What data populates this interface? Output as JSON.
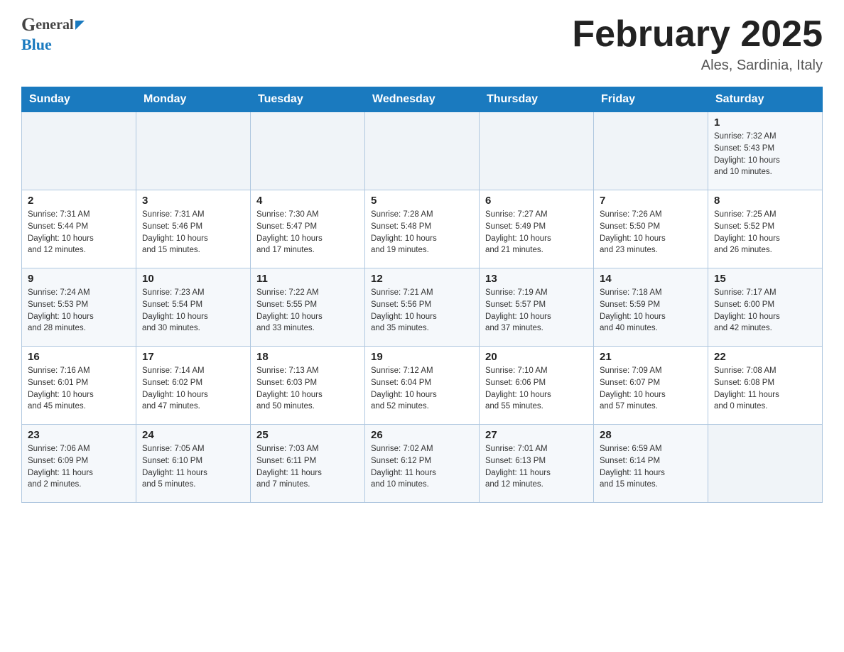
{
  "header": {
    "logo_line1": "General",
    "logo_line2": "Blue",
    "month_title": "February 2025",
    "location": "Ales, Sardinia, Italy"
  },
  "weekdays": [
    "Sunday",
    "Monday",
    "Tuesday",
    "Wednesday",
    "Thursday",
    "Friday",
    "Saturday"
  ],
  "weeks": [
    [
      {
        "day": "",
        "info": ""
      },
      {
        "day": "",
        "info": ""
      },
      {
        "day": "",
        "info": ""
      },
      {
        "day": "",
        "info": ""
      },
      {
        "day": "",
        "info": ""
      },
      {
        "day": "",
        "info": ""
      },
      {
        "day": "1",
        "info": "Sunrise: 7:32 AM\nSunset: 5:43 PM\nDaylight: 10 hours\nand 10 minutes."
      }
    ],
    [
      {
        "day": "2",
        "info": "Sunrise: 7:31 AM\nSunset: 5:44 PM\nDaylight: 10 hours\nand 12 minutes."
      },
      {
        "day": "3",
        "info": "Sunrise: 7:31 AM\nSunset: 5:46 PM\nDaylight: 10 hours\nand 15 minutes."
      },
      {
        "day": "4",
        "info": "Sunrise: 7:30 AM\nSunset: 5:47 PM\nDaylight: 10 hours\nand 17 minutes."
      },
      {
        "day": "5",
        "info": "Sunrise: 7:28 AM\nSunset: 5:48 PM\nDaylight: 10 hours\nand 19 minutes."
      },
      {
        "day": "6",
        "info": "Sunrise: 7:27 AM\nSunset: 5:49 PM\nDaylight: 10 hours\nand 21 minutes."
      },
      {
        "day": "7",
        "info": "Sunrise: 7:26 AM\nSunset: 5:50 PM\nDaylight: 10 hours\nand 23 minutes."
      },
      {
        "day": "8",
        "info": "Sunrise: 7:25 AM\nSunset: 5:52 PM\nDaylight: 10 hours\nand 26 minutes."
      }
    ],
    [
      {
        "day": "9",
        "info": "Sunrise: 7:24 AM\nSunset: 5:53 PM\nDaylight: 10 hours\nand 28 minutes."
      },
      {
        "day": "10",
        "info": "Sunrise: 7:23 AM\nSunset: 5:54 PM\nDaylight: 10 hours\nand 30 minutes."
      },
      {
        "day": "11",
        "info": "Sunrise: 7:22 AM\nSunset: 5:55 PM\nDaylight: 10 hours\nand 33 minutes."
      },
      {
        "day": "12",
        "info": "Sunrise: 7:21 AM\nSunset: 5:56 PM\nDaylight: 10 hours\nand 35 minutes."
      },
      {
        "day": "13",
        "info": "Sunrise: 7:19 AM\nSunset: 5:57 PM\nDaylight: 10 hours\nand 37 minutes."
      },
      {
        "day": "14",
        "info": "Sunrise: 7:18 AM\nSunset: 5:59 PM\nDaylight: 10 hours\nand 40 minutes."
      },
      {
        "day": "15",
        "info": "Sunrise: 7:17 AM\nSunset: 6:00 PM\nDaylight: 10 hours\nand 42 minutes."
      }
    ],
    [
      {
        "day": "16",
        "info": "Sunrise: 7:16 AM\nSunset: 6:01 PM\nDaylight: 10 hours\nand 45 minutes."
      },
      {
        "day": "17",
        "info": "Sunrise: 7:14 AM\nSunset: 6:02 PM\nDaylight: 10 hours\nand 47 minutes."
      },
      {
        "day": "18",
        "info": "Sunrise: 7:13 AM\nSunset: 6:03 PM\nDaylight: 10 hours\nand 50 minutes."
      },
      {
        "day": "19",
        "info": "Sunrise: 7:12 AM\nSunset: 6:04 PM\nDaylight: 10 hours\nand 52 minutes."
      },
      {
        "day": "20",
        "info": "Sunrise: 7:10 AM\nSunset: 6:06 PM\nDaylight: 10 hours\nand 55 minutes."
      },
      {
        "day": "21",
        "info": "Sunrise: 7:09 AM\nSunset: 6:07 PM\nDaylight: 10 hours\nand 57 minutes."
      },
      {
        "day": "22",
        "info": "Sunrise: 7:08 AM\nSunset: 6:08 PM\nDaylight: 11 hours\nand 0 minutes."
      }
    ],
    [
      {
        "day": "23",
        "info": "Sunrise: 7:06 AM\nSunset: 6:09 PM\nDaylight: 11 hours\nand 2 minutes."
      },
      {
        "day": "24",
        "info": "Sunrise: 7:05 AM\nSunset: 6:10 PM\nDaylight: 11 hours\nand 5 minutes."
      },
      {
        "day": "25",
        "info": "Sunrise: 7:03 AM\nSunset: 6:11 PM\nDaylight: 11 hours\nand 7 minutes."
      },
      {
        "day": "26",
        "info": "Sunrise: 7:02 AM\nSunset: 6:12 PM\nDaylight: 11 hours\nand 10 minutes."
      },
      {
        "day": "27",
        "info": "Sunrise: 7:01 AM\nSunset: 6:13 PM\nDaylight: 11 hours\nand 12 minutes."
      },
      {
        "day": "28",
        "info": "Sunrise: 6:59 AM\nSunset: 6:14 PM\nDaylight: 11 hours\nand 15 minutes."
      },
      {
        "day": "",
        "info": ""
      }
    ]
  ]
}
